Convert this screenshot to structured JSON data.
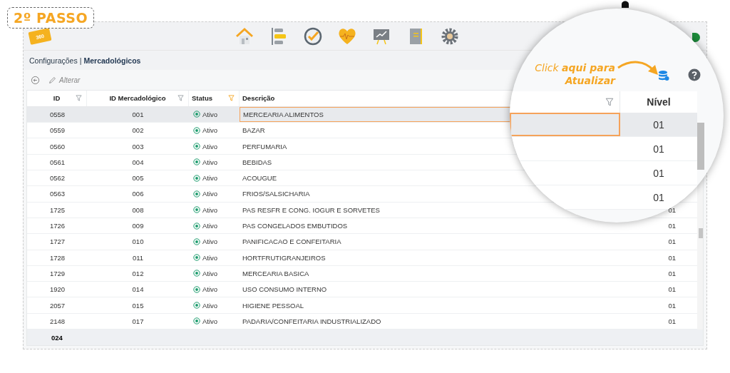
{
  "step_badge": "2º PASSO",
  "logo": "360",
  "breadcrumb": {
    "parent": "Configurações",
    "separator": "|",
    "current": "Mercadológicos"
  },
  "toolbar": {
    "edit_label": "Alterar"
  },
  "table": {
    "columns": [
      {
        "label": "ID",
        "filtered": false
      },
      {
        "label": "ID Mercadológico",
        "filtered": false
      },
      {
        "label": "Status",
        "filtered": true
      },
      {
        "label": "Descrição"
      }
    ],
    "rows": [
      {
        "id": "0558",
        "merc_id": "001",
        "status": "Ativo",
        "description": "MERCEARIA ALIMENTOS",
        "selected": true
      },
      {
        "id": "0559",
        "merc_id": "002",
        "status": "Ativo",
        "description": "BAZAR",
        "selected": false
      },
      {
        "id": "0560",
        "merc_id": "003",
        "status": "Ativo",
        "description": "PERFUMARIA",
        "selected": false
      },
      {
        "id": "0561",
        "merc_id": "004",
        "status": "Ativo",
        "description": "BEBIDAS",
        "selected": false
      },
      {
        "id": "0562",
        "merc_id": "005",
        "status": "Ativo",
        "description": "ACOUGUE",
        "selected": false
      },
      {
        "id": "0563",
        "merc_id": "006",
        "status": "Ativo",
        "description": "FRIOS/SALSICHARIA",
        "selected": false
      },
      {
        "id": "1725",
        "merc_id": "008",
        "status": "Ativo",
        "description": "PAS RESFR E CONG. IOGUR E SORVETES",
        "nivel": "01",
        "selected": false
      },
      {
        "id": "1726",
        "merc_id": "009",
        "status": "Ativo",
        "description": "PAS CONGELADOS EMBUTIDOS",
        "nivel": "01",
        "selected": false
      },
      {
        "id": "1727",
        "merc_id": "010",
        "status": "Ativo",
        "description": "PANIFICACAO E CONFEITARIA",
        "nivel": "01",
        "selected": false
      },
      {
        "id": "1728",
        "merc_id": "011",
        "status": "Ativo",
        "description": "HORTFRUTIGRANJEIROS",
        "nivel": "01",
        "selected": false
      },
      {
        "id": "1729",
        "merc_id": "012",
        "status": "Ativo",
        "description": "MERCEARIA BASICA",
        "nivel": "01",
        "selected": false
      },
      {
        "id": "1920",
        "merc_id": "014",
        "status": "Ativo",
        "description": "USO CONSUMO INTERNO",
        "nivel": "01",
        "selected": false
      },
      {
        "id": "2057",
        "merc_id": "015",
        "status": "Ativo",
        "description": "HIGIENE PESSOAL",
        "nivel": "01",
        "selected": false
      },
      {
        "id": "2148",
        "merc_id": "017",
        "status": "Ativo",
        "description": "PADARIA/CONFEITARIA INDUSTRIALIZADO",
        "nivel": "01",
        "selected": false
      }
    ],
    "footer_count": "024"
  },
  "magnifier": {
    "callout": "Click **aqui para Atualizar**",
    "header": "Nível",
    "cells": [
      {
        "text": "01",
        "selected": true
      },
      {
        "text": "01",
        "selected": false
      },
      {
        "text": "01",
        "selected": false
      },
      {
        "text": "01",
        "selected": false
      }
    ]
  }
}
